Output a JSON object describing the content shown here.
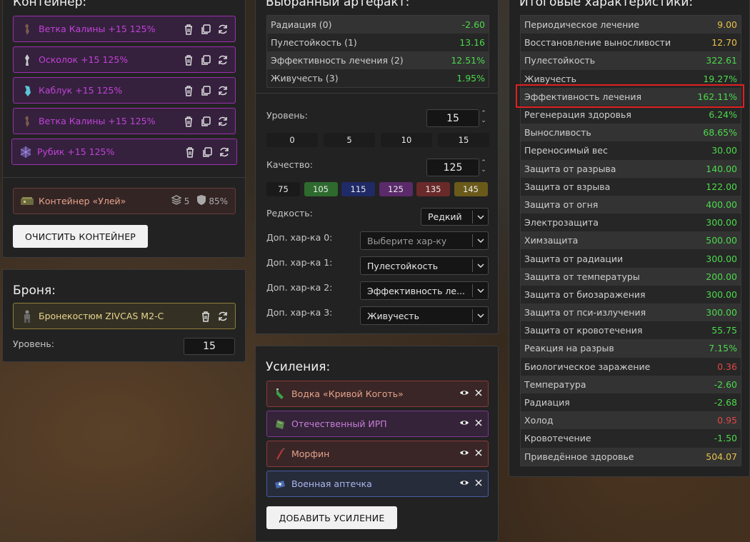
{
  "container": {
    "title": "Контейнер:",
    "slots": [
      {
        "label": "Ветка Калины +15 125%",
        "icon": "branch-icon"
      },
      {
        "label": "Осколок +15 125%",
        "icon": "shard-icon"
      },
      {
        "label": "Каблук +15 125%",
        "icon": "heel-icon"
      },
      {
        "label": "Ветка Калины +15 125%",
        "icon": "branch-icon"
      },
      {
        "label": "Рубик +15 125%",
        "icon": "rubik-icon"
      }
    ],
    "hive_label": "Контейнер «Улей»",
    "hive_slots": "5",
    "hive_protection": "85%",
    "clear_button": "ОЧИСТИТЬ КОНТЕЙНЕР"
  },
  "armor": {
    "title": "Броня:",
    "item": "Бронекостюм ZIVCAS M2-C",
    "level_label": "Уровень:",
    "level_value": "15"
  },
  "artifact": {
    "title": "Выбранный артефакт:",
    "stats": [
      {
        "name": "Радиация (0)",
        "value": "-2.60",
        "color": "good"
      },
      {
        "name": "Пулестойкость (1)",
        "value": "13.16",
        "color": "good"
      },
      {
        "name": "Эффективность лечения (2)",
        "value": "12.51%",
        "color": "good"
      },
      {
        "name": "Живучесть (3)",
        "value": "1.95%",
        "color": "good"
      }
    ],
    "level_label": "Уровень:",
    "level_value": "15",
    "level_presets": [
      "0",
      "5",
      "10",
      "15"
    ],
    "quality_label": "Качество:",
    "quality_value": "125",
    "quality_presets": [
      {
        "label": "75",
        "color": "#1a1a1a"
      },
      {
        "label": "105",
        "color": "#2e6a2e"
      },
      {
        "label": "115",
        "color": "#1f2a66"
      },
      {
        "label": "125",
        "color": "#5a2a6a"
      },
      {
        "label": "135",
        "color": "#6a2a2a"
      },
      {
        "label": "145",
        "color": "#6a5a1a"
      }
    ],
    "rarity_label": "Редкость:",
    "rarity_value": "Редкий",
    "extra": [
      {
        "label": "Доп. хар-ка 0:",
        "value": "Выберите хар-ку",
        "placeholder": true
      },
      {
        "label": "Доп. хар-ка 1:",
        "value": "Пулестойкость",
        "placeholder": false
      },
      {
        "label": "Доп. хар-ка 2:",
        "value": "Эффективность ле...",
        "placeholder": false
      },
      {
        "label": "Доп. хар-ка 3:",
        "value": "Живучесть",
        "placeholder": false
      }
    ]
  },
  "boosts": {
    "title": "Усиления:",
    "items": [
      {
        "label": "Водка «Кривой Коготь»",
        "icon": "vodka-bottle-icon",
        "tone": "red"
      },
      {
        "label": "Отечественный ИРП",
        "icon": "ration-pack-icon",
        "tone": "purple"
      },
      {
        "label": "Морфин",
        "icon": "syringe-icon",
        "tone": "red"
      },
      {
        "label": "Военная аптечка",
        "icon": "medkit-icon",
        "tone": "blue"
      }
    ],
    "add_button": "ДОБАВИТЬ УСИЛЕНИЕ"
  },
  "totals": {
    "title": "Итоговые характеристики:",
    "rows": [
      {
        "name": "Периодическое лечение",
        "value": "9.00",
        "color": "yellow"
      },
      {
        "name": "Восстановление выносливости",
        "value": "12.70",
        "color": "yellow"
      },
      {
        "name": "Пулестойкость",
        "value": "322.61",
        "color": "green"
      },
      {
        "name": "Живучесть",
        "value": "19.27%",
        "color": "green"
      },
      {
        "name": "Эффективность лечения",
        "value": "162.11%",
        "color": "green"
      },
      {
        "name": "Регенерация здоровья",
        "value": "6.24%",
        "color": "green"
      },
      {
        "name": "Выносливость",
        "value": "68.65%",
        "color": "green"
      },
      {
        "name": "Переносимый вес",
        "value": "30.00",
        "color": "green"
      },
      {
        "name": "Защита от разрыва",
        "value": "140.00",
        "color": "green"
      },
      {
        "name": "Защита от взрыва",
        "value": "122.00",
        "color": "green"
      },
      {
        "name": "Защита от огня",
        "value": "400.00",
        "color": "green"
      },
      {
        "name": "Электрозащита",
        "value": "300.00",
        "color": "green"
      },
      {
        "name": "Химзащита",
        "value": "500.00",
        "color": "green"
      },
      {
        "name": "Защита от радиации",
        "value": "300.00",
        "color": "green"
      },
      {
        "name": "Защита от температуры",
        "value": "200.00",
        "color": "green"
      },
      {
        "name": "Защита от биозаражения",
        "value": "300.00",
        "color": "green"
      },
      {
        "name": "Защита от пси-излучения",
        "value": "300.00",
        "color": "green"
      },
      {
        "name": "Защита от кровотечения",
        "value": "55.75",
        "color": "green"
      },
      {
        "name": "Реакция на разрыв",
        "value": "7.15%",
        "color": "green"
      },
      {
        "name": "Биологическое заражение",
        "value": "0.36",
        "color": "red"
      },
      {
        "name": "Температура",
        "value": "-2.60",
        "color": "green"
      },
      {
        "name": "Радиация",
        "value": "-2.68",
        "color": "green"
      },
      {
        "name": "Холод",
        "value": "0.95",
        "color": "red"
      },
      {
        "name": "Кровотечение",
        "value": "-1.50",
        "color": "green"
      },
      {
        "name": "Приведённое здоровье",
        "value": "504.07",
        "color": "yellow"
      }
    ],
    "highlighted_row": 4
  },
  "colors": {
    "green": "#4cd94c",
    "red": "#e04848",
    "yellow": "#e8c14a",
    "highlight": "#e02020"
  }
}
